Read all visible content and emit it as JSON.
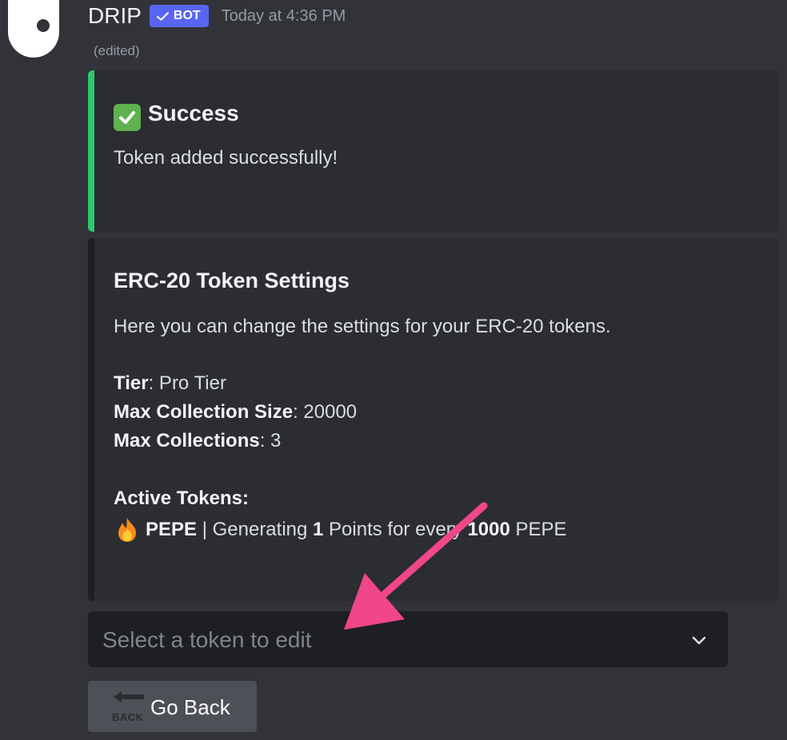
{
  "message": {
    "author": "DRIP",
    "badge": "BOT",
    "timestamp": "Today at 4:36 PM",
    "edited_label": "(edited)"
  },
  "success_embed": {
    "title": "Success",
    "description": "Token added successfully!",
    "accent_color": "#2dc770",
    "icon": "check-mark-icon"
  },
  "settings_embed": {
    "title": "ERC-20 Token Settings",
    "description": "Here you can change the settings for your ERC-20 tokens.",
    "fields": [
      {
        "label": "Tier",
        "value": ": Pro Tier"
      },
      {
        "label": "Max Collection Size",
        "value": ": 20000"
      },
      {
        "label": "Max Collections",
        "value": ": 3"
      }
    ],
    "active_tokens_title": "Active Tokens:",
    "active_token": {
      "icon": "fire-icon",
      "name": "PEPE",
      "text1": " | Generating ",
      "points": "1",
      "text2": " Points for every ",
      "amount": "1000",
      "text3": " PEPE"
    }
  },
  "select_menu": {
    "placeholder": "Select a token to edit",
    "icon": "chevron-down-icon"
  },
  "back_button": {
    "label": "Go Back",
    "icon_text": "BACK",
    "icon": "back-arrow-icon"
  },
  "annotation": {
    "icon": "pink-arrow-icon",
    "color": "#f0468a"
  }
}
